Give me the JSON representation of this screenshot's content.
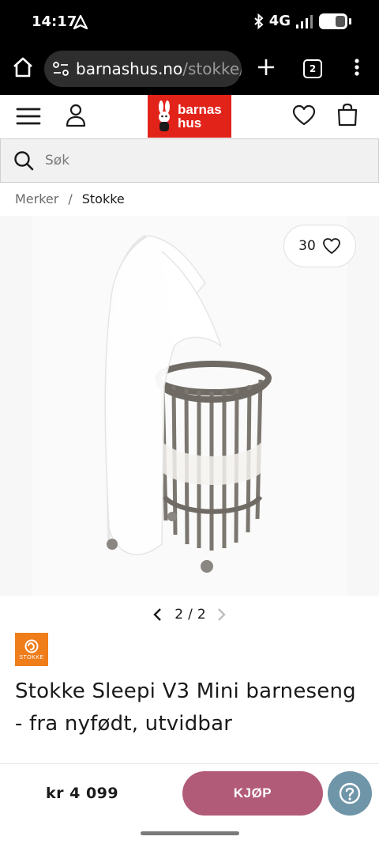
{
  "status_bar": {
    "time": "14:17",
    "network": "4G",
    "icons": [
      "navigation-arrow-icon",
      "bluetooth-icon",
      "signal-icon",
      "battery-icon"
    ]
  },
  "browser": {
    "url_host": "barnashus.no",
    "url_path": "/stokke/",
    "tab_count": "2",
    "icons": [
      "home-icon",
      "site-settings-icon",
      "plus-icon",
      "tabs-icon",
      "more-vert-icon"
    ]
  },
  "header": {
    "logo_line1": "barnas",
    "logo_line2": "hus",
    "icons": [
      "menu-icon",
      "user-icon",
      "heart-icon",
      "bag-icon"
    ]
  },
  "search": {
    "placeholder": "Søk",
    "value": ""
  },
  "breadcrumb": {
    "items": [
      {
        "label": "Merker"
      },
      {
        "label": "Stokke"
      }
    ],
    "separator": "/"
  },
  "gallery": {
    "likes": "30",
    "current": "2",
    "total": "2",
    "separator": "/"
  },
  "brand": {
    "name": "STOKKE",
    "color": "#ef7d1a"
  },
  "product": {
    "title": "Stokke Sleepi V3 Mini barneseng - fra nyfødt, utvidbar",
    "price": "kr 4 099"
  },
  "actions": {
    "buy_label": "KJØP",
    "buy_color": "#b25b79",
    "help_color": "#6f95a8"
  }
}
